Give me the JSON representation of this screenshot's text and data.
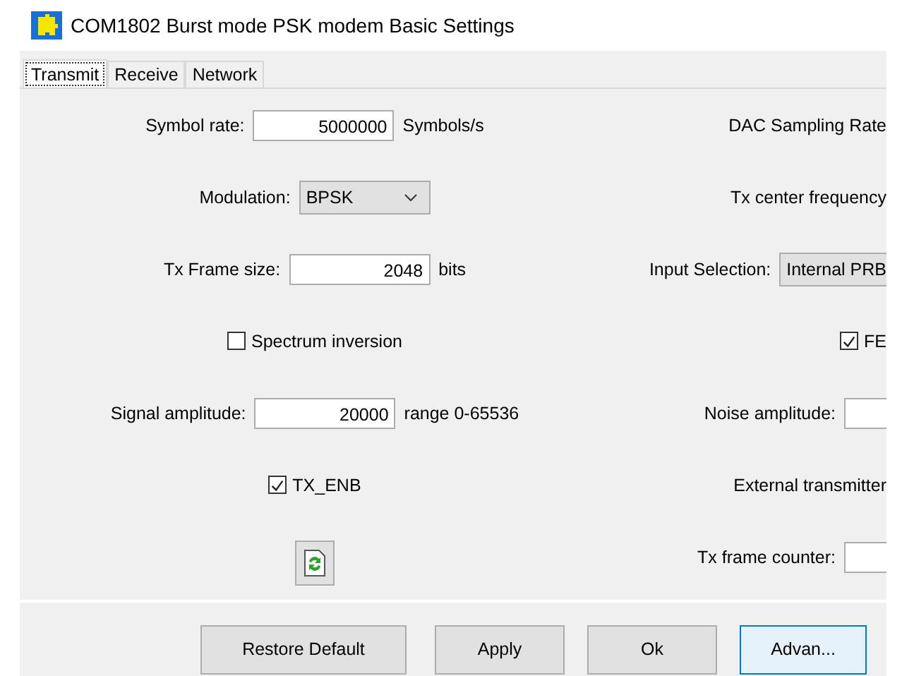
{
  "window": {
    "title": "COM1802 Burst mode PSK modem Basic Settings"
  },
  "tabs": [
    {
      "label": "Transmit",
      "selected": true
    },
    {
      "label": "Receive",
      "selected": false
    },
    {
      "label": "Network",
      "selected": false
    }
  ],
  "left": [
    {
      "kind": "field",
      "label": "Symbol rate:",
      "value": "5000000",
      "unit": "Symbols/s"
    },
    {
      "kind": "select",
      "label": "Modulation:",
      "value": "BPSK"
    },
    {
      "kind": "field",
      "label": "Tx Frame size:",
      "value": "2048",
      "unit": "bits"
    },
    {
      "kind": "checkbox",
      "label": "Spectrum inversion",
      "checked": false
    },
    {
      "kind": "field",
      "label": "Signal amplitude:",
      "value": "20000",
      "unit": "range 0-65536"
    },
    {
      "kind": "checkbox",
      "label": "TX_ENB",
      "checked": true
    },
    {
      "kind": "iconbutton"
    }
  ],
  "right": [
    {
      "kind": "text",
      "label": "DAC Sampling Rate"
    },
    {
      "kind": "text",
      "label": "Tx center frequency"
    },
    {
      "kind": "combo",
      "label": "Input Selection:",
      "value": "Internal PRB"
    },
    {
      "kind": "checkbox",
      "label": "FE",
      "checked": true
    },
    {
      "kind": "field",
      "label": "Noise amplitude:"
    },
    {
      "kind": "text",
      "label": "External transmitter"
    },
    {
      "kind": "field",
      "label": "Tx frame counter:"
    }
  ],
  "buttons": [
    {
      "label": "Restore Default",
      "focused": false
    },
    {
      "label": "Apply",
      "focused": false
    },
    {
      "label": "Ok",
      "focused": false
    },
    {
      "label": "Advan...",
      "focused": true
    }
  ]
}
